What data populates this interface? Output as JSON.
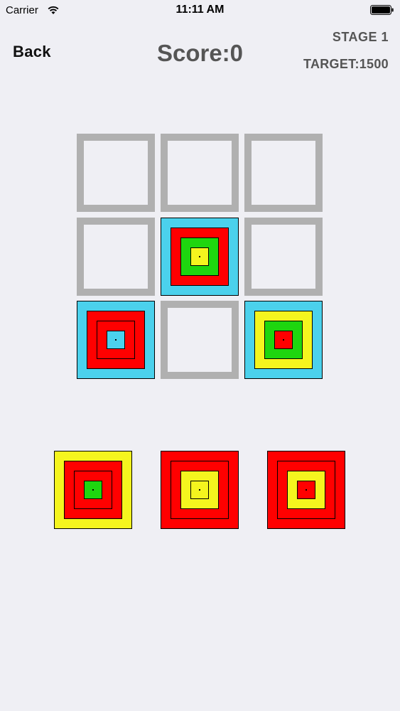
{
  "status_bar": {
    "carrier": "Carrier",
    "time": "11:11 AM"
  },
  "header": {
    "back_label": "Back",
    "score_label": "Score:0",
    "stage_label": "STAGE 1",
    "target_label": "TARGET:1500"
  },
  "colors": {
    "cyan": "#4bd1ec",
    "red": "#ff0000",
    "green": "#1ed60f",
    "yellow": "#f5f51e",
    "empty_border": "#b0b0b0",
    "background": "#efeff4"
  },
  "board": {
    "rows": 3,
    "cols": 3,
    "cells": [
      {
        "row": 0,
        "col": 0,
        "rings": []
      },
      {
        "row": 0,
        "col": 1,
        "rings": []
      },
      {
        "row": 0,
        "col": 2,
        "rings": []
      },
      {
        "row": 1,
        "col": 0,
        "rings": []
      },
      {
        "row": 1,
        "col": 1,
        "rings": [
          "cyan",
          "red",
          "green",
          "yellow"
        ]
      },
      {
        "row": 1,
        "col": 2,
        "rings": []
      },
      {
        "row": 2,
        "col": 0,
        "rings": [
          "cyan",
          "red",
          "red",
          "cyan"
        ]
      },
      {
        "row": 2,
        "col": 1,
        "rings": []
      },
      {
        "row": 2,
        "col": 2,
        "rings": [
          "cyan",
          "yellow",
          "green",
          "red"
        ]
      }
    ]
  },
  "tray": {
    "pieces": [
      {
        "rings": [
          "yellow",
          "red",
          "red",
          "green"
        ]
      },
      {
        "rings": [
          "red",
          "red",
          "yellow",
          "yellow"
        ]
      },
      {
        "rings": [
          "red",
          "red",
          "yellow",
          "red"
        ]
      }
    ]
  }
}
